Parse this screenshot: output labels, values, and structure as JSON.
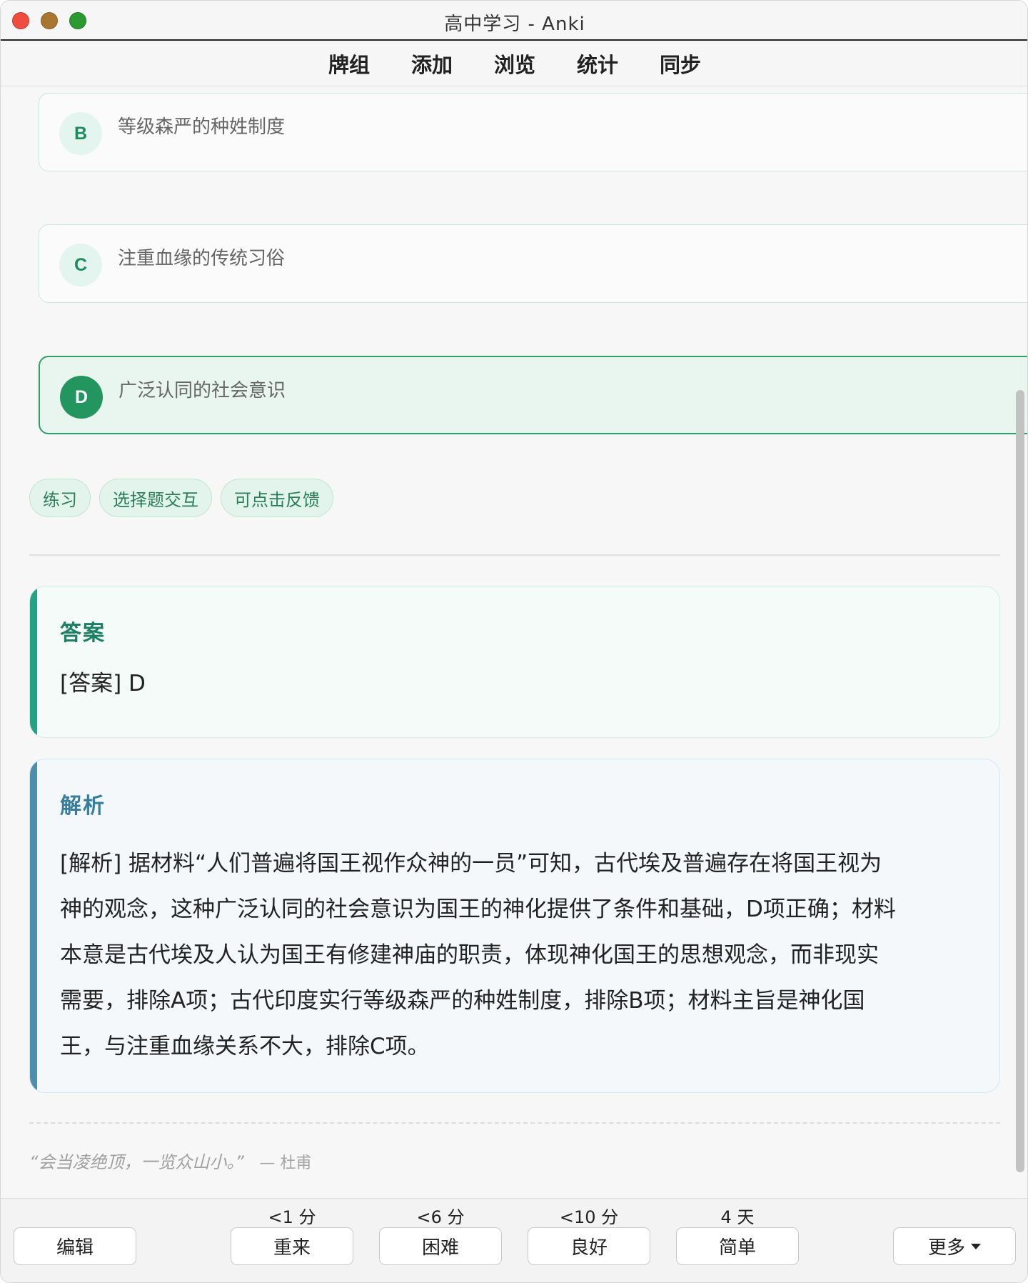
{
  "window": {
    "title": "高中学习 - Anki"
  },
  "toolbar": {
    "items": [
      "牌组",
      "添加",
      "浏览",
      "统计",
      "同步"
    ]
  },
  "options": [
    {
      "letter": "B",
      "text": "等级森严的种姓制度",
      "selected": false
    },
    {
      "letter": "C",
      "text": "注重血缘的传统习俗",
      "selected": false
    },
    {
      "letter": "D",
      "text": "广泛认同的社会意识",
      "selected": true
    }
  ],
  "tags": [
    "练习",
    "选择题交互",
    "可点击反馈"
  ],
  "answer": {
    "title": "答案",
    "body": "[答案] D"
  },
  "analysis": {
    "title": "解析",
    "lines": [
      "[解析] 据材料“人们普遍将国王视作众神的一员”可知，古代埃及普遍存在将国王视为",
      "神的观念，这种广泛认同的社会意识为国王的神化提供了条件和基础，D项正确；材料",
      "本意是古代埃及人认为国王有修建神庙的职责，体现神化国王的思想观念，而非现实",
      "需要，排除A项；古代印度实行等级森严的种姓制度，排除B项；材料主旨是神化国",
      "王，与注重血缘关系不大，排除C项。"
    ]
  },
  "quote": {
    "text": "“会当凌绝顶，一览众山小。”",
    "author": "— 杜甫"
  },
  "bottom": {
    "edit_label": "编辑",
    "answers": [
      {
        "interval": "<1 分",
        "label": "重来"
      },
      {
        "interval": "<6 分",
        "label": "困难"
      },
      {
        "interval": "<10 分",
        "label": "良好"
      },
      {
        "interval": "4 天",
        "label": "简单"
      }
    ],
    "more_label": "更多"
  }
}
